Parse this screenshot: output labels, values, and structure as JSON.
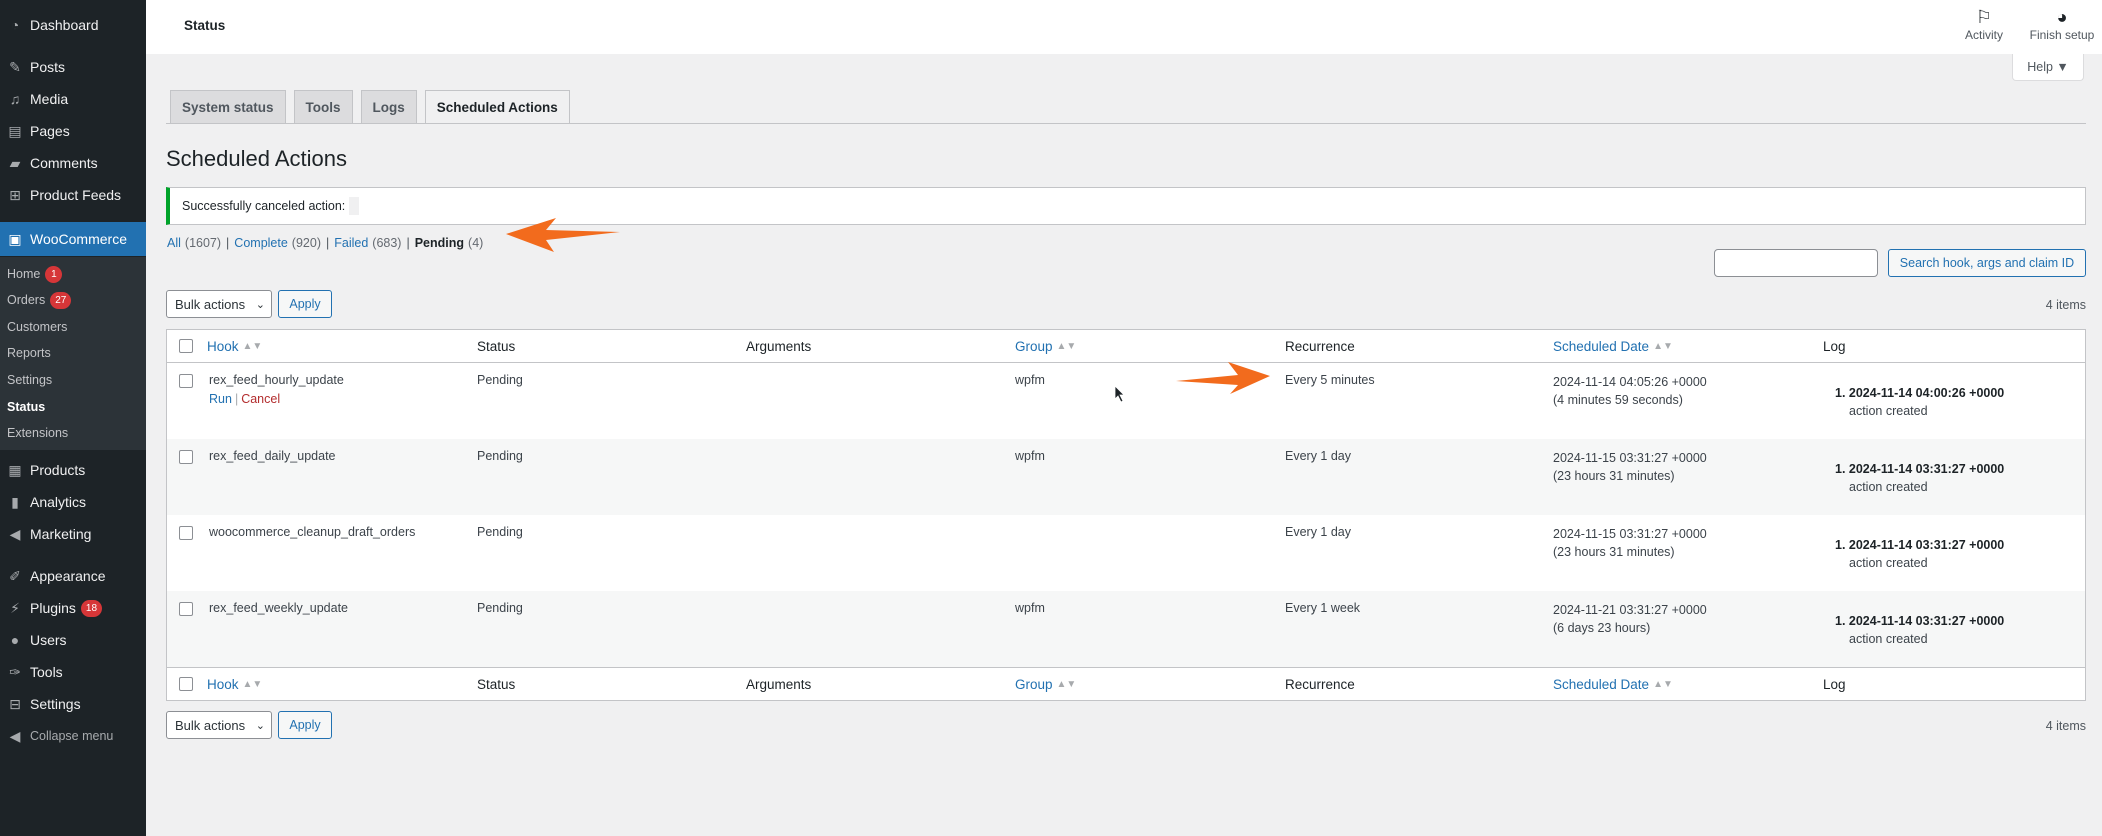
{
  "sidebar": {
    "items": [
      {
        "label": "Dashboard",
        "icon": "dashboard-icon"
      },
      {
        "label": "Posts",
        "icon": "pin-icon"
      },
      {
        "label": "Media",
        "icon": "media-icon"
      },
      {
        "label": "Pages",
        "icon": "pages-icon"
      },
      {
        "label": "Comments",
        "icon": "comment-icon"
      },
      {
        "label": "Product Feeds",
        "icon": "feed-icon"
      },
      {
        "label": "WooCommerce",
        "icon": "woo-icon"
      },
      {
        "label": "Products",
        "icon": "products-icon"
      },
      {
        "label": "Analytics",
        "icon": "analytics-icon"
      },
      {
        "label": "Marketing",
        "icon": "megaphone-icon"
      },
      {
        "label": "Appearance",
        "icon": "brush-icon"
      },
      {
        "label": "Plugins",
        "icon": "plugin-icon",
        "count": "18"
      },
      {
        "label": "Users",
        "icon": "user-icon"
      },
      {
        "label": "Tools",
        "icon": "wrench-icon"
      },
      {
        "label": "Settings",
        "icon": "settings-icon"
      },
      {
        "label": "Collapse menu",
        "icon": "collapse-icon"
      }
    ],
    "woo_submenu": [
      {
        "label": "Home",
        "count": "1"
      },
      {
        "label": "Orders",
        "count": "27"
      },
      {
        "label": "Customers"
      },
      {
        "label": "Reports"
      },
      {
        "label": "Settings"
      },
      {
        "label": "Status"
      },
      {
        "label": "Extensions"
      }
    ]
  },
  "header": {
    "title": "Status",
    "activity_label": "Activity",
    "finish_setup_label": "Finish setup",
    "help_label": "Help ▼"
  },
  "tabs": [
    "System status",
    "Tools",
    "Logs",
    "Scheduled Actions"
  ],
  "page_title": "Scheduled Actions",
  "notice": "Successfully canceled action:",
  "filters": {
    "all": {
      "label": "All",
      "count": "(1607)"
    },
    "complete": {
      "label": "Complete",
      "count": "(920)"
    },
    "failed": {
      "label": "Failed",
      "count": "(683)"
    },
    "pending": {
      "label": "Pending",
      "count": "(4)"
    }
  },
  "search": {
    "placeholder": "",
    "button": "Search hook, args and claim ID"
  },
  "bulk": {
    "label": "Bulk actions",
    "apply": "Apply",
    "items_count": "4 items"
  },
  "table": {
    "columns": [
      "Hook",
      "Status",
      "Arguments",
      "Group",
      "Recurrence",
      "Scheduled Date",
      "Log"
    ],
    "row_actions": {
      "run": "Run",
      "cancel": "Cancel"
    },
    "rows": [
      {
        "hook": "rex_feed_hourly_update",
        "status": "Pending",
        "arguments": "",
        "group": "wpfm",
        "recurrence": "Every 5 minutes",
        "date": "2024-11-14 04:05:26 +0000",
        "date_rel": "(4 minutes 59 seconds)",
        "log_date": "2024-11-14 04:00:26 +0000",
        "log_msg": "action created"
      },
      {
        "hook": "rex_feed_daily_update",
        "status": "Pending",
        "arguments": "",
        "group": "wpfm",
        "recurrence": "Every 1 day",
        "date": "2024-11-15 03:31:27 +0000",
        "date_rel": "(23 hours 31 minutes)",
        "log_date": "2024-11-14 03:31:27 +0000",
        "log_msg": "action created"
      },
      {
        "hook": "woocommerce_cleanup_draft_orders",
        "status": "Pending",
        "arguments": "",
        "group": "",
        "recurrence": "Every 1 day",
        "date": "2024-11-15 03:31:27 +0000",
        "date_rel": "(23 hours 31 minutes)",
        "log_date": "2024-11-14 03:31:27 +0000",
        "log_msg": "action created"
      },
      {
        "hook": "rex_feed_weekly_update",
        "status": "Pending",
        "arguments": "",
        "group": "wpfm",
        "recurrence": "Every 1 week",
        "date": "2024-11-21 03:31:27 +0000",
        "date_rel": "(6 days 23 hours)",
        "log_date": "2024-11-14 03:31:27 +0000",
        "log_msg": "action created"
      }
    ]
  },
  "colors": {
    "accent": "#2271b1",
    "sidebar": "#1d2327",
    "arrow": "#f26b1d",
    "success": "#00a32a",
    "badge": "#d63638"
  }
}
